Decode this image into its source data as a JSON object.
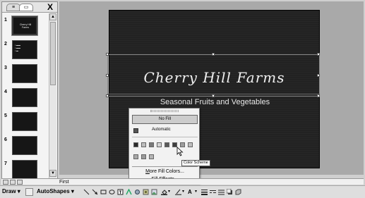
{
  "left_panel": {
    "tab_outline_icon": "outline-icon",
    "tab_slides_icon": "slides-icon",
    "close_label": "X",
    "thumbnails": [
      {
        "num": "1",
        "title": "Cherry Hill Farms",
        "selected": true
      },
      {
        "num": "2"
      },
      {
        "num": "3"
      },
      {
        "num": "4"
      },
      {
        "num": "5"
      },
      {
        "num": "6"
      },
      {
        "num": "7"
      }
    ]
  },
  "slide": {
    "title": "Cherry Hill Farms",
    "subtitle": "Seasonal Fruits and Vegetables"
  },
  "fill_popup": {
    "no_fill": "No Fill",
    "automatic": "Automatic",
    "scheme_colors": [
      "#2a2a2a",
      "#bdbdbd",
      "#7a7a7a",
      "#d4d4d4",
      "#5a5a5a",
      "#3d3d3d",
      "#9c9c9c",
      "#bfbfbf"
    ],
    "recent_colors": [
      "#a8a8a8",
      "#9a9a9a",
      "#b4b4b4"
    ],
    "tooltip": "Color Scheme",
    "more_fill_colors": "More Fill Colors...",
    "fill_effects": "Fill Effects..."
  },
  "notes": {
    "text": "First"
  },
  "draw_toolbar": {
    "draw_label": "Draw",
    "autoshapes_label": "AutoShapes"
  }
}
